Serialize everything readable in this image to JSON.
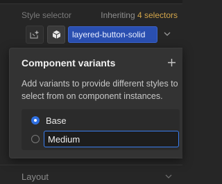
{
  "style_selector": {
    "label": "Style selector",
    "inheriting_prefix": "Inheriting",
    "inheriting_count": "4 selectors",
    "class_name": "layered-button-solid",
    "icons": [
      "add-class-icon",
      "cube-icon",
      "chevron-down-icon"
    ]
  },
  "popover": {
    "title": "Component variants",
    "description": "Add variants to provide different styles to select from on component instances.",
    "variants": [
      {
        "label": "Base",
        "selected": true
      },
      {
        "value": "Medium",
        "selected": false
      }
    ]
  },
  "layout_section": {
    "label": "Layout"
  },
  "colors": {
    "accent": "#2f6fe0",
    "pill": "#2a4fb0",
    "inherit_count": "#d3a54a"
  }
}
